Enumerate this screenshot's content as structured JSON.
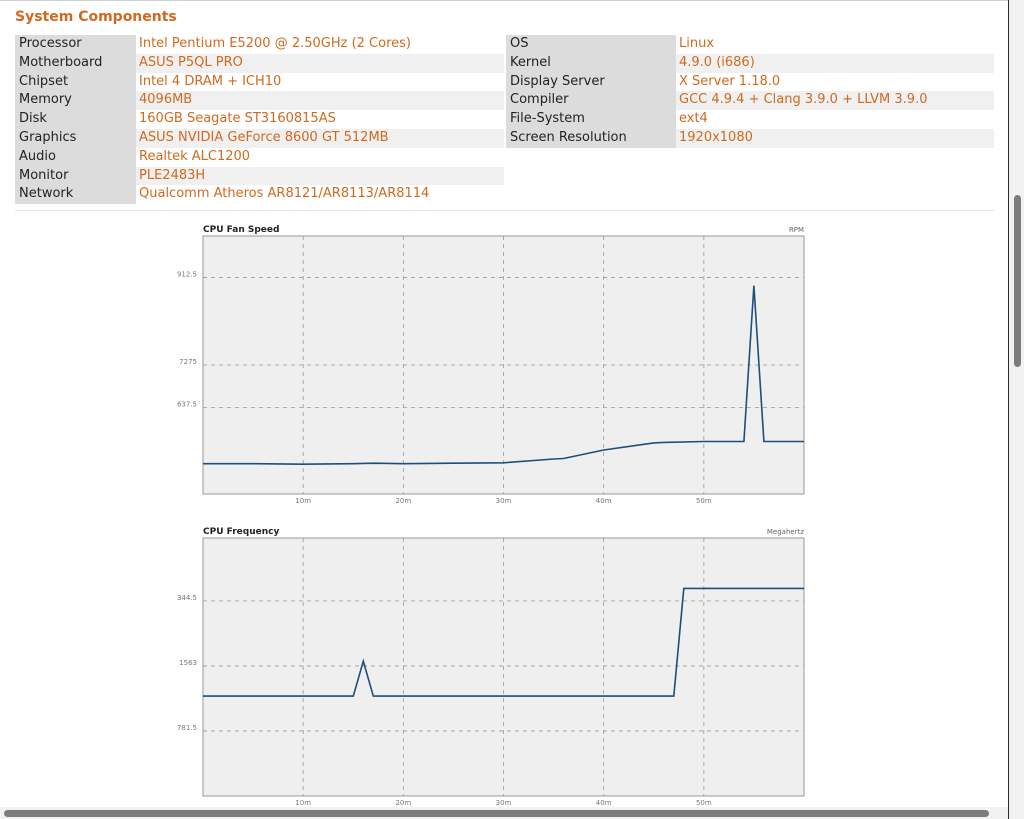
{
  "section_title": "System Components",
  "components_left": [
    {
      "label": "Processor",
      "value": "Intel Pentium E5200 @ 2.50GHz (2 Cores)"
    },
    {
      "label": "Motherboard",
      "value": "ASUS P5QL PRO"
    },
    {
      "label": "Chipset",
      "value": "Intel 4 DRAM + ICH10"
    },
    {
      "label": "Memory",
      "value": "4096MB"
    },
    {
      "label": "Disk",
      "value": "160GB Seagate ST3160815AS"
    },
    {
      "label": "Graphics",
      "value": "ASUS NVIDIA GeForce 8600 GT 512MB"
    },
    {
      "label": "Audio",
      "value": "Realtek ALC1200"
    },
    {
      "label": "Monitor",
      "value": "PLE2483H"
    },
    {
      "label": "Network",
      "value": "Qualcomm Atheros AR8121/AR8113/AR8114"
    }
  ],
  "components_right": [
    {
      "label": "OS",
      "value": "Linux"
    },
    {
      "label": "Kernel",
      "value": "4.9.0 (i686)"
    },
    {
      "label": "Display Server",
      "value": "X Server 1.18.0"
    },
    {
      "label": "Compiler",
      "value": "GCC 4.9.4 + Clang 3.9.0 + LLVM 3.9.0"
    },
    {
      "label": "File-System",
      "value": "ext4"
    },
    {
      "label": "Screen Resolution",
      "value": "1920x1080"
    }
  ],
  "colors": {
    "accent": "#d2691e",
    "line": "#1f4e79",
    "plot_bg": "#efefef"
  },
  "chart_data": [
    {
      "type": "line",
      "title": "CPU Fan Speed",
      "unit_label": "RPM",
      "x_ticks": [
        "10m",
        "20m",
        "30m",
        "40m",
        "50m"
      ],
      "x_tick_values": [
        10,
        20,
        30,
        40,
        50
      ],
      "xlim": [
        0,
        60
      ],
      "y_ticks": [
        "637.5",
        "7275",
        "912.5"
      ],
      "y_tick_values": [
        637.5,
        727.5,
        912.5
      ],
      "ylim": [
        455,
        1000
      ],
      "series": [
        {
          "x": [
            0,
            5,
            10,
            15,
            17,
            20,
            25,
            30,
            35,
            36,
            40,
            45,
            46,
            50,
            54,
            55,
            56,
            60
          ],
          "values": [
            519,
            519,
            518,
            519,
            520,
            519,
            520,
            521,
            529,
            530,
            548,
            563,
            564,
            566,
            566,
            895,
            566,
            566
          ]
        }
      ]
    },
    {
      "type": "line",
      "title": "CPU Frequency",
      "unit_label": "Megahertz",
      "x_ticks": [
        "10m",
        "20m",
        "30m",
        "40m",
        "50m"
      ],
      "x_tick_values": [
        10,
        20,
        30,
        40,
        50
      ],
      "xlim": [
        0,
        60
      ],
      "y_ticks": [
        "781.5",
        "1563",
        "344.5"
      ],
      "y_tick_values": [
        781.5,
        1563,
        2344.5
      ],
      "ylim": [
        0,
        3100
      ],
      "series": [
        {
          "x": [
            0,
            15,
            16,
            17,
            47,
            48,
            60
          ],
          "values": [
            1200,
            1200,
            1620,
            1200,
            1200,
            2495,
            2495
          ]
        }
      ]
    }
  ]
}
